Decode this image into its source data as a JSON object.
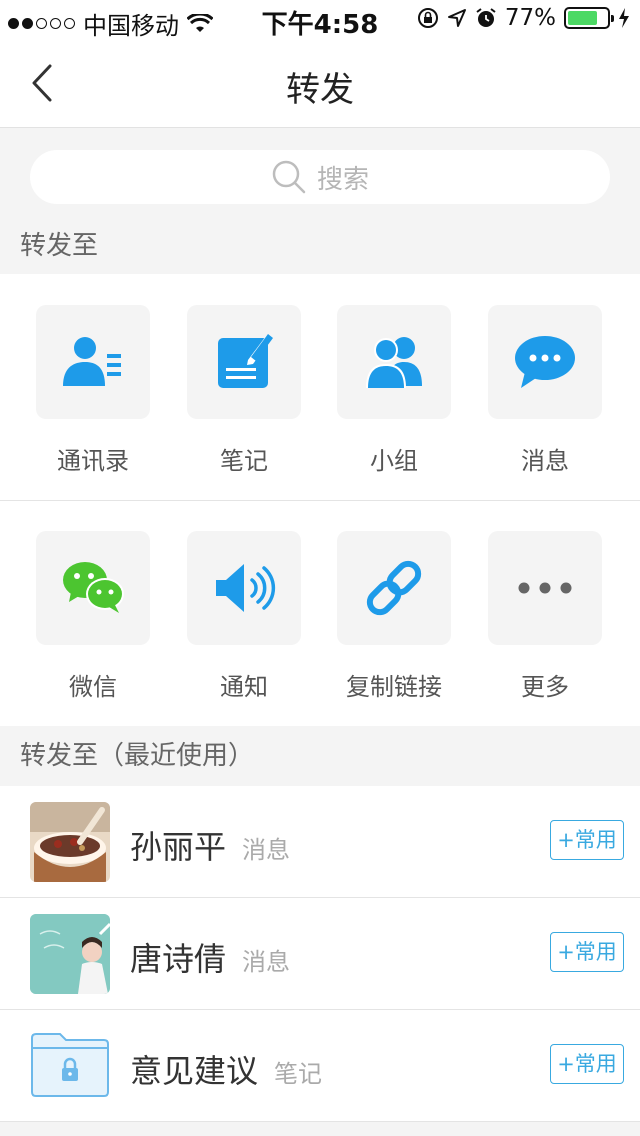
{
  "status_bar": {
    "carrier": "中国移动",
    "time": "下午4:58",
    "battery_percent": "77%",
    "battery_level": 0.77
  },
  "nav": {
    "title": "转发"
  },
  "search": {
    "placeholder": "搜索"
  },
  "section_forward_to": "转发至",
  "grid": [
    {
      "label": "通讯录",
      "icon": "contacts-icon"
    },
    {
      "label": "笔记",
      "icon": "note-icon"
    },
    {
      "label": "小组",
      "icon": "group-icon"
    },
    {
      "label": "消息",
      "icon": "message-icon"
    },
    {
      "label": "微信",
      "icon": "wechat-icon"
    },
    {
      "label": "通知",
      "icon": "speaker-icon"
    },
    {
      "label": "复制链接",
      "icon": "link-icon"
    },
    {
      "label": "更多",
      "icon": "more-icon"
    }
  ],
  "section_recent": "转发至（最近使用）",
  "recent": [
    {
      "name": "孙丽平",
      "type": "消息",
      "button": "+常用"
    },
    {
      "name": "唐诗倩",
      "type": "消息",
      "button": "+常用"
    },
    {
      "name": "意见建议",
      "type": "笔记",
      "button": "+常用"
    }
  ],
  "colors": {
    "accent": "#1e9be9",
    "wechat": "#4cc530",
    "battery": "#4cd964"
  }
}
